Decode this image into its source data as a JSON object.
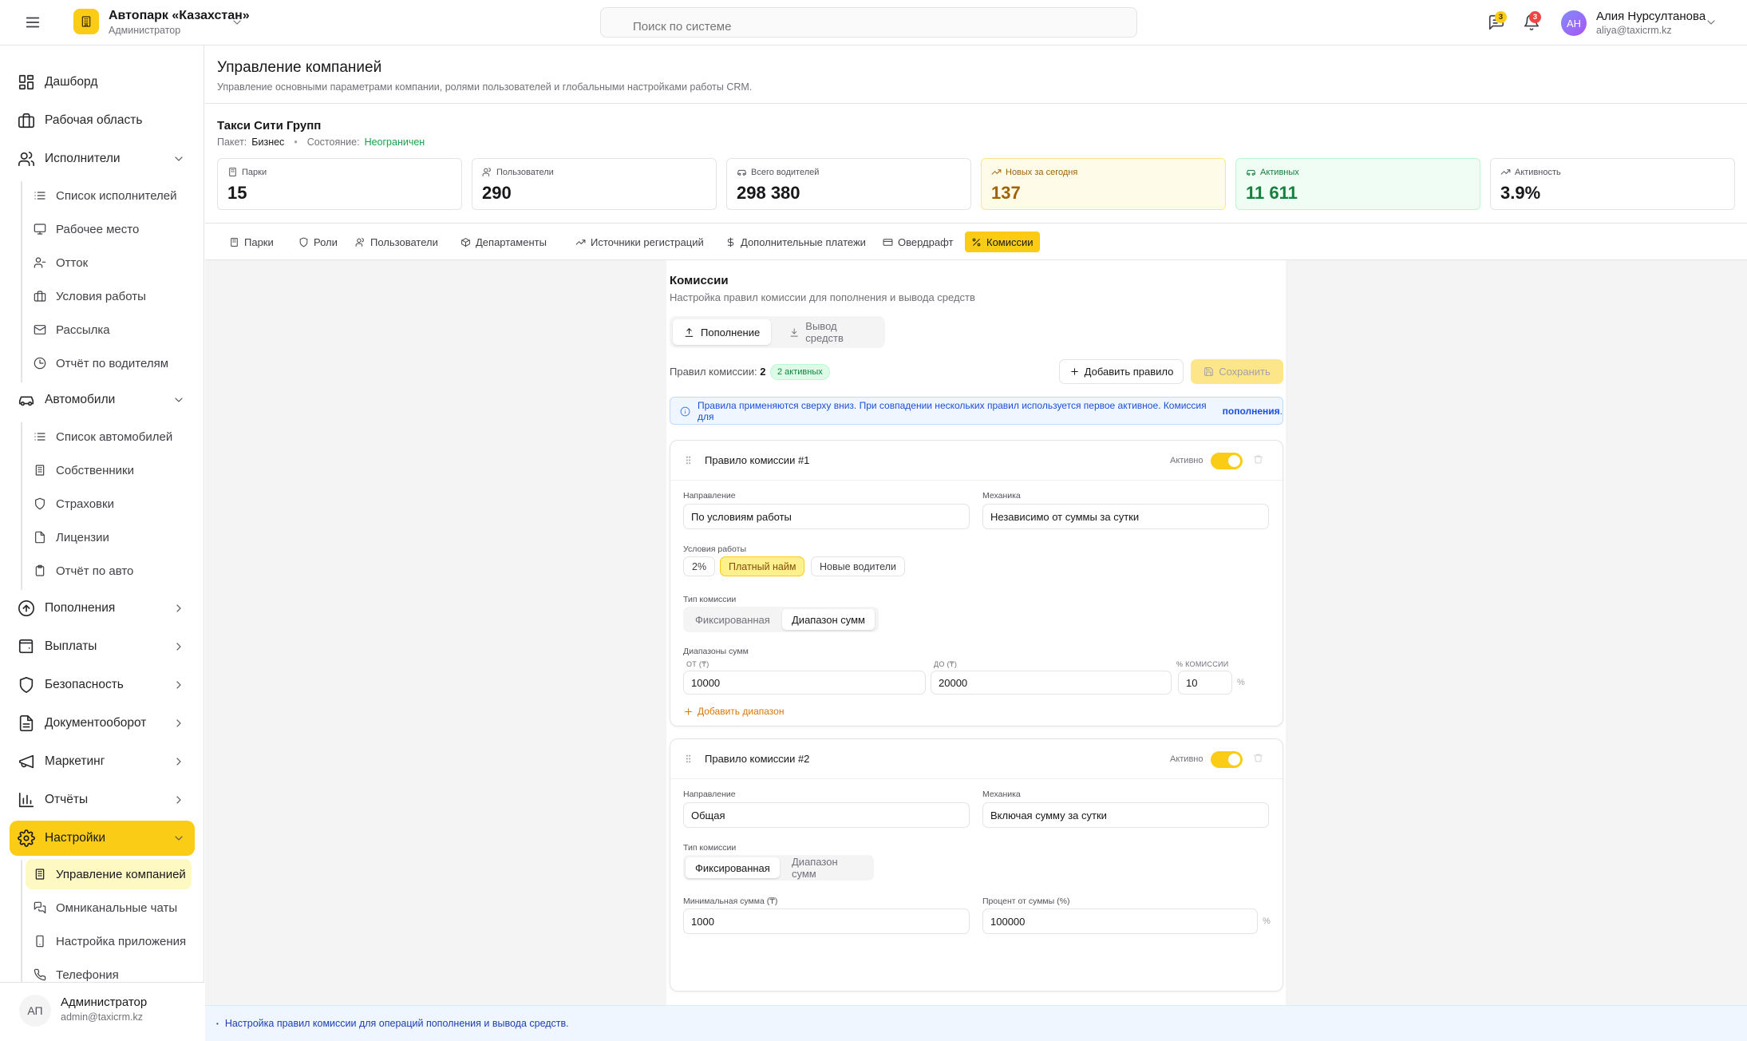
{
  "header": {
    "company": "Автопарк «Казахстан»",
    "role": "Администратор",
    "search_placeholder": "Поиск по системе",
    "messages_badge": "3",
    "notifications_badge": "3",
    "user_initials": "АН",
    "user_name": "Алия Нурсултанова",
    "user_email": "aliya@taxicrm.kz"
  },
  "sidebar": {
    "dashboard": "Дашборд",
    "workspace": "Рабочая область",
    "executors": "Исполнители",
    "executors_sub": [
      "Список исполнителей",
      "Рабочее место",
      "Отток",
      "Условия работы",
      "Рассылка",
      "Отчёт по водителям"
    ],
    "cars": "Автомобили",
    "cars_sub": [
      "Список автомобилей",
      "Собственники",
      "Страховки",
      "Лицензии",
      "Отчёт по авто"
    ],
    "topups": "Пополнения",
    "payouts": "Выплаты",
    "security": "Безопасность",
    "docflow": "Документооборот",
    "marketing": "Маркетинг",
    "reports": "Отчёты",
    "settings": "Настройки",
    "settings_sub": [
      "Управление компанией",
      "Омниканальные чаты",
      "Настройка приложения",
      "Телефония"
    ],
    "footer_initials": "АП",
    "footer_name": "Администратор",
    "footer_email": "admin@taxicrm.kz"
  },
  "page": {
    "title": "Управление компанией",
    "subtitle": "Управление основными параметрами компании, ролями пользователей и глобальными настройками работы CRM.",
    "company_name": "Такси Сити Групп",
    "package_label": "Пакет:",
    "package_value": "Бизнес",
    "state_label": "Состояние:",
    "state_value": "Неограничен"
  },
  "stats": [
    {
      "label": "Парки",
      "value": "15"
    },
    {
      "label": "Пользователи",
      "value": "290"
    },
    {
      "label": "Всего водителей",
      "value": "298 380"
    },
    {
      "label": "Новых за сегодня",
      "value": "137"
    },
    {
      "label": "Активных",
      "value": "11 611"
    },
    {
      "label": "Активность",
      "value": "3.9%"
    }
  ],
  "tabs": [
    "Парки",
    "Роли",
    "Пользователи",
    "Департаменты",
    "Источники регистраций",
    "Дополнительные платежи",
    "Овердрафт",
    "Комиссии"
  ],
  "commissions": {
    "title": "Комиссии",
    "subtitle": "Настройка правил комиссии для пополнения и вывода средств",
    "seg_topup": "Пополнение",
    "seg_withdraw": "Вывод средств",
    "rules_label": "Правил комиссии:",
    "rules_count": "2",
    "active_pill": "2 активных",
    "add_rule": "Добавить правило",
    "save": "Сохранить",
    "info_text": "Правила применяются сверху вниз. При совпадении нескольких правил используется первое активное. Комиссия для",
    "info_bold": "пополнения",
    "info_end": "."
  },
  "rule1": {
    "title": "Правило комиссии #1",
    "active_label": "Активно",
    "direction_label": "Направление",
    "direction_value": "По условиям работы",
    "mechanics_label": "Механика",
    "mechanics_value": "Независимо от суммы за сутки",
    "conditions_label": "Условия работы",
    "chips": [
      "2%",
      "Платный найм",
      "Новые водители"
    ],
    "type_label": "Тип комиссии",
    "type_fixed": "Фиксированная",
    "type_range": "Диапазон сумм",
    "ranges_label": "Диапазоны сумм",
    "from_label": "ОТ (₸)",
    "to_label": "ДО (₸)",
    "pct_label": "% КОМИССИИ",
    "from_value": "10000",
    "to_value": "20000",
    "pct_value": "10",
    "pct_unit": "%",
    "add_range": "Добавить диапазон"
  },
  "rule2": {
    "title": "Правило комиссии #2",
    "active_label": "Активно",
    "direction_label": "Направление",
    "direction_value": "Общая",
    "mechanics_label": "Механика",
    "mechanics_value": "Включая сумму за сутки",
    "type_label": "Тип комиссии",
    "type_fixed": "Фиксированная",
    "type_range": "Диапазон сумм",
    "min_label": "Минимальная сумма (₸)",
    "min_value": "1000",
    "pct_label": "Процент от суммы (%)",
    "pct_value": "100000",
    "pct_unit": "%"
  },
  "footer_note": "Настройка правил комиссии для операций пополнения и вывода средств.",
  "colors": {
    "accent": "#facc15",
    "success": "#16a34a",
    "info": "#1d4ed8"
  }
}
